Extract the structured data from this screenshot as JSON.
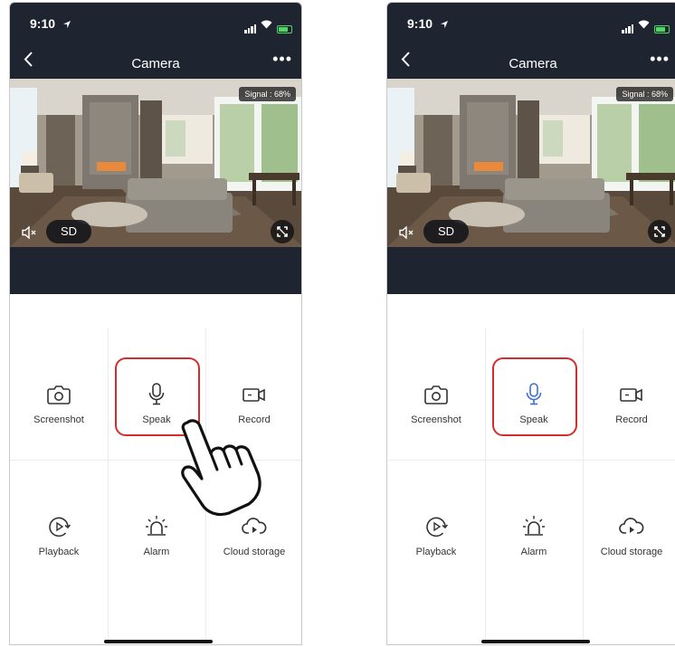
{
  "panels": [
    {
      "status_time": "9:10",
      "nav_title": "Camera",
      "signal_badge": "Signal : 68%",
      "quality_label": "SD",
      "features": [
        {
          "label": "Screenshot",
          "icon": "camera-icon"
        },
        {
          "label": "Speak",
          "icon": "microphone-icon"
        },
        {
          "label": "Record",
          "icon": "video-camera-icon"
        },
        {
          "label": "Playback",
          "icon": "playback-icon"
        },
        {
          "label": "Alarm",
          "icon": "siren-icon"
        },
        {
          "label": "Cloud storage",
          "icon": "cloud-icon"
        }
      ]
    },
    {
      "status_time": "9:10",
      "nav_title": "Camera",
      "signal_badge": "Signal : 68%",
      "quality_label": "SD",
      "features": [
        {
          "label": "Screenshot",
          "icon": "camera-icon"
        },
        {
          "label": "Speak",
          "icon": "microphone-icon"
        },
        {
          "label": "Record",
          "icon": "video-camera-icon"
        },
        {
          "label": "Playback",
          "icon": "playback-icon"
        },
        {
          "label": "Alarm",
          "icon": "siren-icon"
        },
        {
          "label": "Cloud storage",
          "icon": "cloud-icon"
        }
      ]
    }
  ],
  "colors": {
    "header_bg": "#1f2431",
    "highlight": "#d62c2c",
    "speak_active": "#3d6fd8",
    "icon_default": "#333333"
  }
}
